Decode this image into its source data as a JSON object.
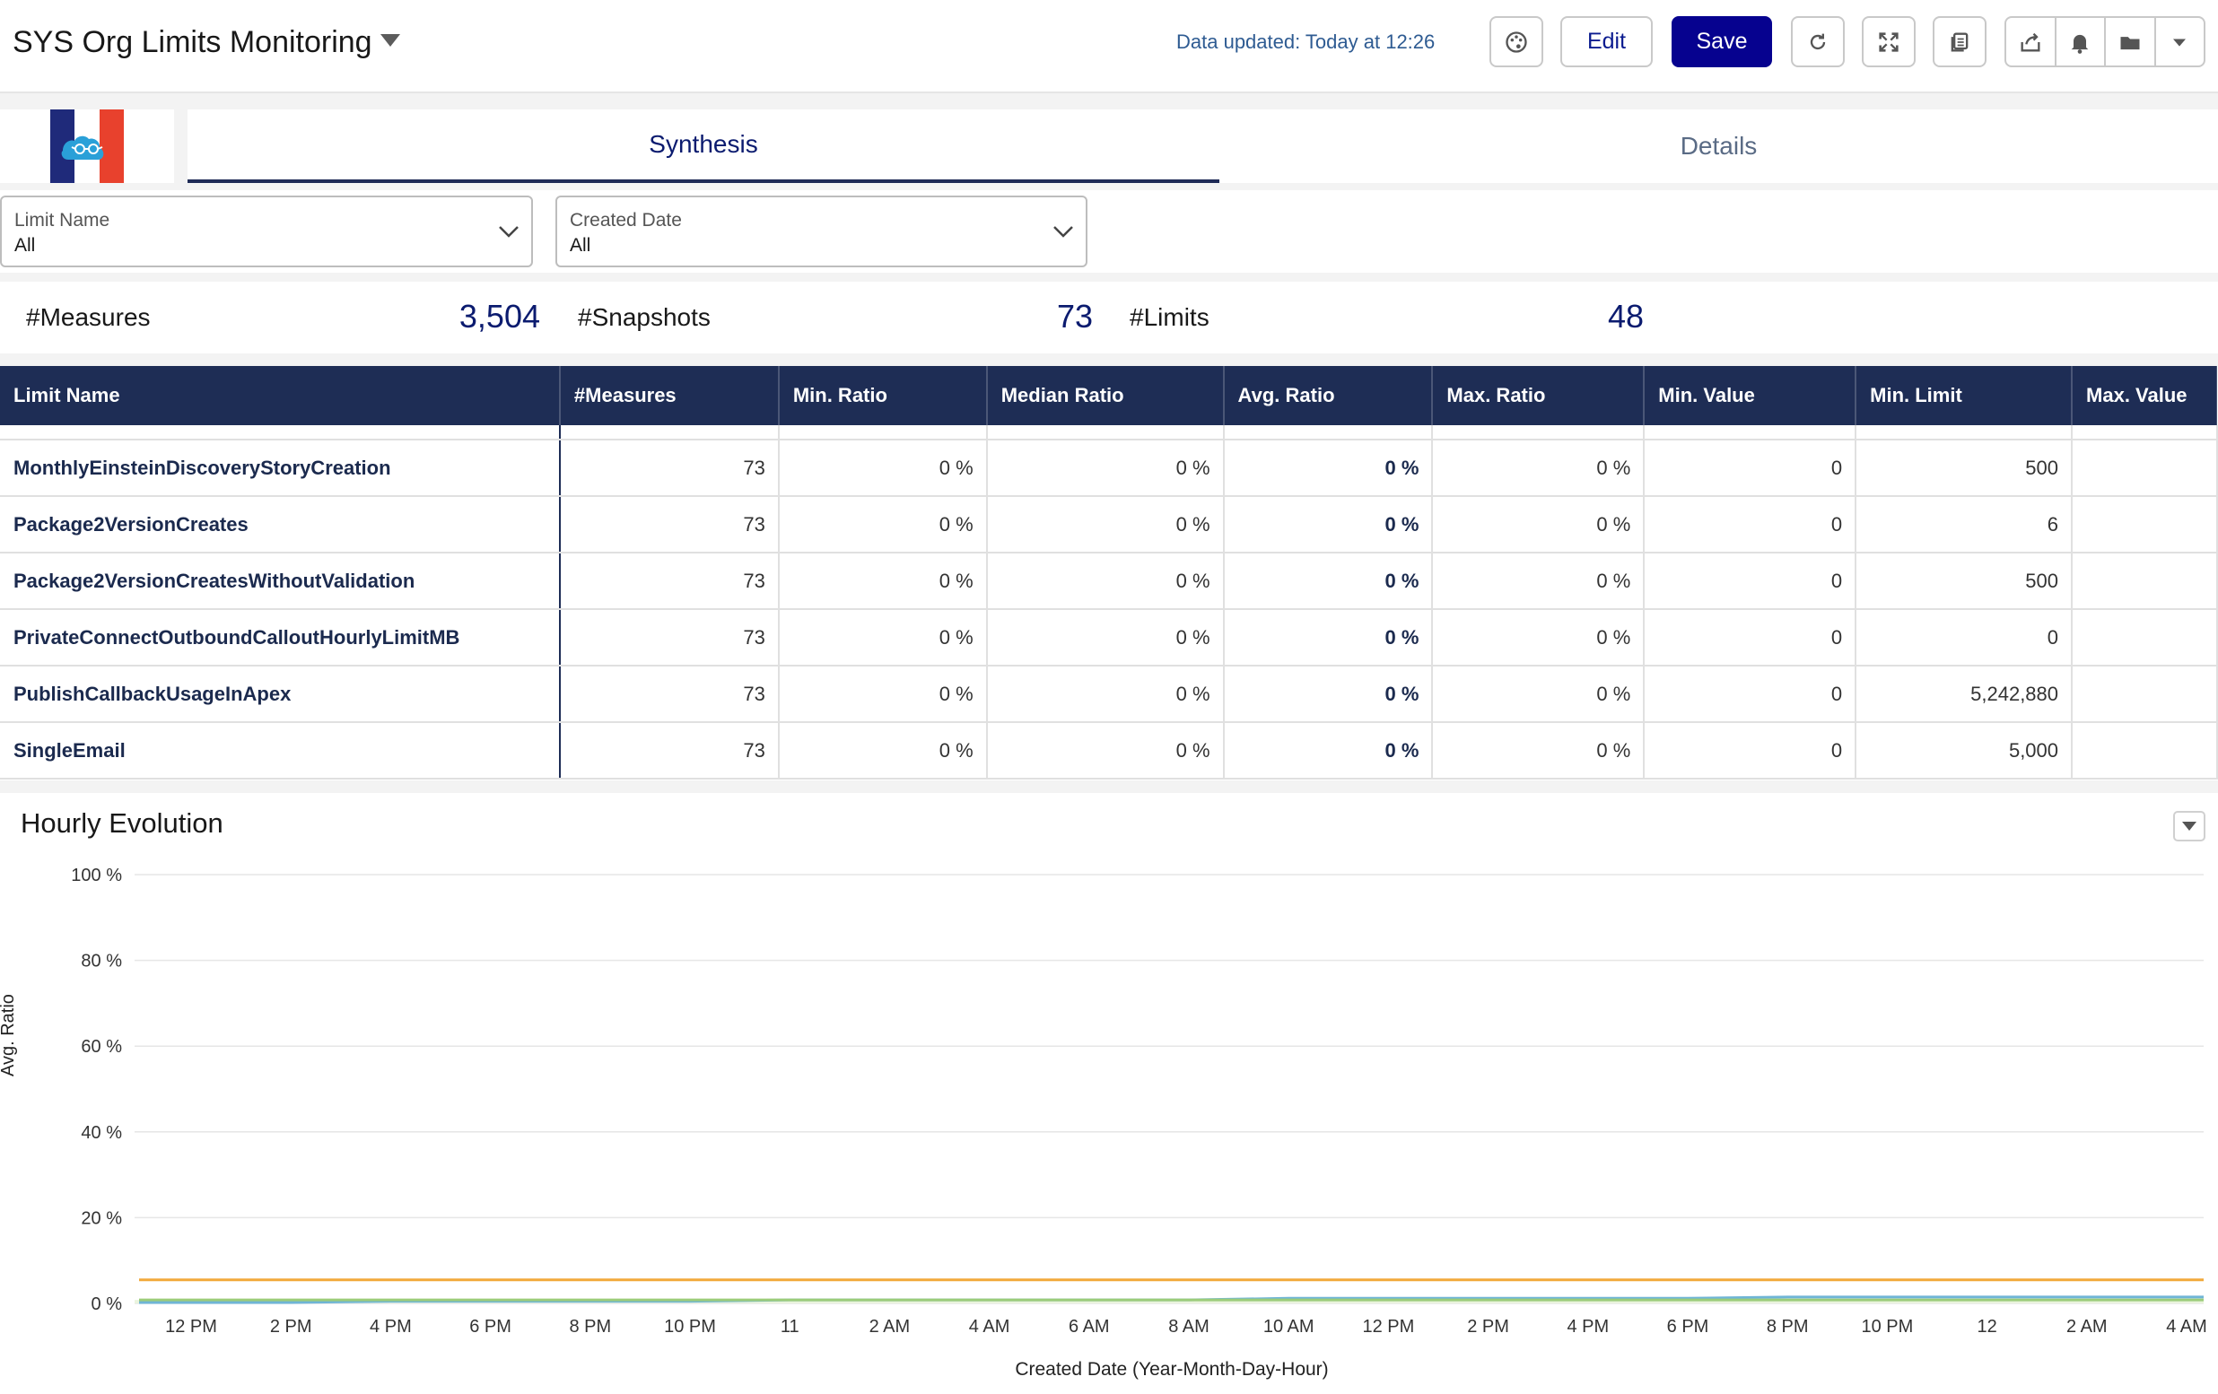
{
  "header": {
    "title": "SYS Org Limits Monitoring",
    "updated": "Data updated: Today at 12:26",
    "edit_label": "Edit",
    "save_label": "Save"
  },
  "tabs": [
    {
      "label": "Synthesis",
      "active": true
    },
    {
      "label": "Details",
      "active": false
    }
  ],
  "filters": [
    {
      "label": "Limit Name",
      "value": "All"
    },
    {
      "label": "Created Date",
      "value": "All"
    }
  ],
  "kpis": [
    {
      "label": "#Measures",
      "value": "3,504"
    },
    {
      "label": "#Snapshots",
      "value": "73"
    },
    {
      "label": "#Limits",
      "value": "48"
    }
  ],
  "table": {
    "columns": [
      "Limit Name",
      "#Measures",
      "Min. Ratio",
      "Median Ratio",
      "Avg. Ratio",
      "Max. Ratio",
      "Min. Value",
      "Min. Limit",
      "Max. Value"
    ],
    "rows": [
      [
        "MonthlyEinsteinDiscoveryStoryCreation",
        "73",
        "0 %",
        "0 %",
        "0 %",
        "0 %",
        "0",
        "500",
        ""
      ],
      [
        "Package2VersionCreates",
        "73",
        "0 %",
        "0 %",
        "0 %",
        "0 %",
        "0",
        "6",
        ""
      ],
      [
        "Package2VersionCreatesWithoutValidation",
        "73",
        "0 %",
        "0 %",
        "0 %",
        "0 %",
        "0",
        "500",
        ""
      ],
      [
        "PrivateConnectOutboundCalloutHourlyLimitMB",
        "73",
        "0 %",
        "0 %",
        "0 %",
        "0 %",
        "0",
        "0",
        ""
      ],
      [
        "PublishCallbackUsageInApex",
        "73",
        "0 %",
        "0 %",
        "0 %",
        "0 %",
        "0",
        "5,242,880",
        ""
      ],
      [
        "SingleEmail",
        "73",
        "0 %",
        "0 %",
        "0 %",
        "0 %",
        "0",
        "5,000",
        ""
      ]
    ]
  },
  "chart_title": "Hourly Evolution",
  "chart_data": {
    "type": "line",
    "title": "Hourly Evolution",
    "xlabel": "Created Date (Year-Month-Day-Hour)",
    "ylabel": "Avg. Ratio",
    "ylim": [
      0,
      100
    ],
    "yticks": [
      "100 %",
      "80 %",
      "60 %",
      "40 %",
      "20 %",
      "0 %"
    ],
    "categories": [
      "12 PM",
      "2 PM",
      "4 PM",
      "6 PM",
      "8 PM",
      "10 PM",
      "11",
      "2 AM",
      "4 AM",
      "6 AM",
      "8 AM",
      "10 AM",
      "12 PM",
      "2 PM",
      "4 PM",
      "6 PM",
      "8 PM",
      "10 PM",
      "12",
      "2 AM",
      "4 AM"
    ],
    "grid": true,
    "series": [
      {
        "color": "#f2a93b",
        "values": [
          5.5,
          5.5,
          5.5,
          5.5,
          5.5,
          5.5,
          5.5,
          5.5,
          5.5,
          5.5,
          5.5,
          5.5,
          5.5,
          5.5,
          5.5,
          5.5,
          5.5,
          5.5,
          5.5,
          5.5,
          5.5
        ]
      },
      {
        "color": "#6fb5d6",
        "values": [
          0.2,
          0.2,
          0.5,
          0.5,
          0.5,
          0.5,
          0.8,
          0.8,
          0.8,
          0.8,
          0.8,
          1.2,
          1.2,
          1.2,
          1.2,
          1.2,
          1.5,
          1.5,
          1.5,
          1.5,
          1.5
        ]
      },
      {
        "color": "#9ccc7a",
        "values": [
          0.8,
          0.8,
          0.8,
          0.8,
          0.8,
          0.8,
          0.8,
          0.8,
          0.8,
          0.8,
          0.8,
          0.8,
          0.8,
          0.8,
          0.8,
          0.8,
          0.8,
          0.8,
          0.8,
          0.8,
          0.8
        ]
      }
    ]
  },
  "colors": {
    "accent": "#06028f",
    "header_table": "#1e2d55",
    "kpi": "#0b1b6f"
  }
}
